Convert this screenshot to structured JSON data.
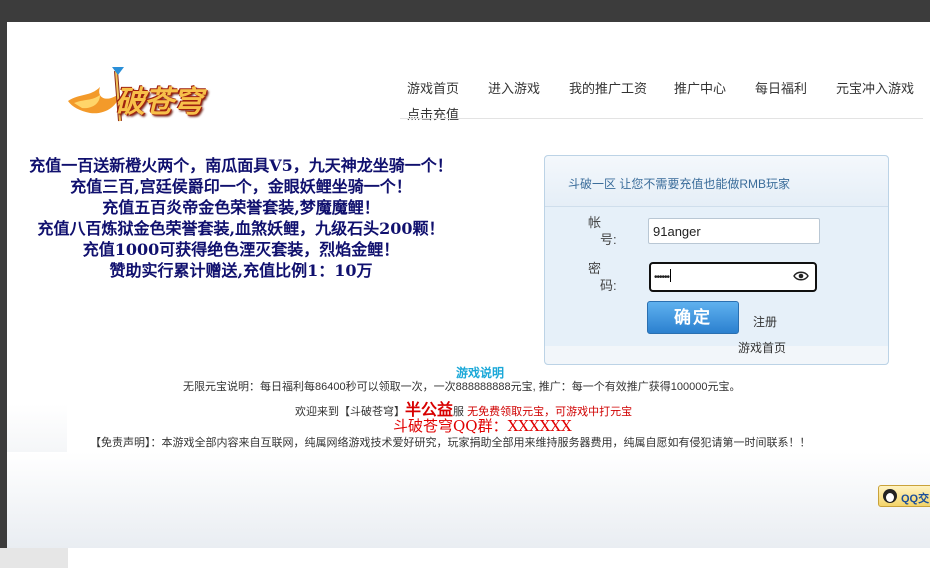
{
  "logo": {
    "text": "破苍穹"
  },
  "nav": [
    {
      "label": "游戏首页"
    },
    {
      "label": "进入游戏"
    },
    {
      "label": "我的推广工资"
    },
    {
      "label": "推广中心"
    },
    {
      "label": "每日福利"
    },
    {
      "label": "元宝冲入游戏"
    },
    {
      "label": "点击充值"
    }
  ],
  "promo": [
    "充值一百送新橙火两个，南瓜面具V5，九天神龙坐骑一个！",
    "充值三百,宫廷侯爵印一个，金眼妖鲤坐骑一个！",
    "充值五百炎帝金色荣誉套装,梦魔魔鲤！",
    "充值八百炼狱金色荣誉套装,血煞妖鲤，九级石头200颗！",
    "充值1000可获得绝色湮灭套装，烈焰金鲤！",
    "赞助实行累计赠送,充值比例1：10万"
  ],
  "login": {
    "server_text": "斗破一区 让您不需要充值也能做RMB玩家",
    "account_label_1": "帐",
    "account_label_2": "号:",
    "account_value": "91anger",
    "password_label_1": "密",
    "password_label_2": "码:",
    "password_value": "••••••",
    "submit_label": "确定",
    "register_label": "注册",
    "home_label": "游戏首页"
  },
  "info": {
    "title": "游戏说明",
    "line1": "无限元宝说明：每日福利每86400秒可以领取一次，一次888888888元宝, 推广：每一个有效推广获得100000元宝。",
    "line2_a": "欢迎来到【斗破苍穹】",
    "line2_b": "半公益",
    "line2_c": "服",
    "line2_d": "无免费领取元宝，可游戏中打元宝",
    "qq_line": "斗破苍穹QQ群：XXXXXX",
    "disclaimer": "【免责声明】：本游戏全部内容来自互联网，纯属网络游戏技术爱好研究，玩家捐助全部用来维持服务器费用，纯属自愿如有侵犯请第一时间联系！！",
    "qq_badge": "QQ交"
  }
}
